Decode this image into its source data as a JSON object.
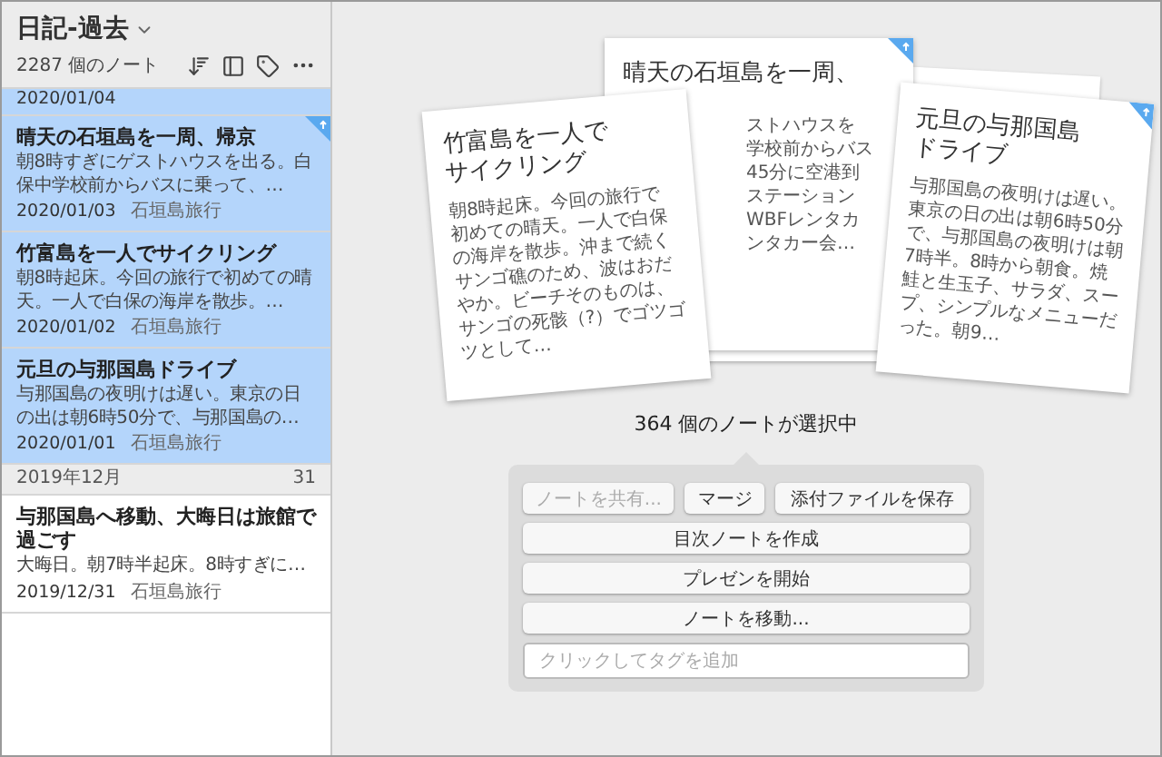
{
  "sidebar": {
    "title": "日記-過去",
    "note_count": "2287 個のノート",
    "notes": [
      {
        "kind": "partial",
        "date": "2020/01/04",
        "selected": true,
        "shortcut": false
      },
      {
        "kind": "note",
        "title": "晴天の石垣島を一周、帰京",
        "snippet": "朝8時すぎにゲストハウスを出る。白保中学校前からバスに乗って、…",
        "date": "2020/01/03",
        "tag": "石垣島旅行",
        "selected": true,
        "shortcut": true
      },
      {
        "kind": "note",
        "title": "竹富島を一人でサイクリング",
        "snippet": "朝8時起床。今回の旅行で初めての晴天。一人で白保の海岸を散歩。…",
        "date": "2020/01/02",
        "tag": "石垣島旅行",
        "selected": true,
        "shortcut": false
      },
      {
        "kind": "note",
        "title": "元旦の与那国島ドライブ",
        "snippet": "与那国島の夜明けは遅い。東京の日の出は朝6時50分で、与那国島の…",
        "date": "2020/01/01",
        "tag": "石垣島旅行",
        "selected": true,
        "shortcut": false
      },
      {
        "kind": "section",
        "label": "2019年12月",
        "count": "31"
      },
      {
        "kind": "note",
        "title": "与那国島へ移動、大晦日は旅館で過ごす",
        "snippet": "大晦日。朝7時半起床。8時すぎに…",
        "date": "2019/12/31",
        "tag": "石垣島旅行",
        "selected": false,
        "shortcut": false
      }
    ]
  },
  "preview": {
    "cards": [
      {
        "kind": "back",
        "title": "晴天の石垣島を一周、",
        "lines": [
          "ストハウスを",
          "学校前からバス",
          "45分に空港到",
          "ステーション",
          "WBFレンタカ",
          "ンタカー会…"
        ],
        "shortcut": true
      },
      {
        "kind": "left",
        "title": "竹富島を一人でサイクリング",
        "body": "朝8時起床。今回の旅行で初めての晴天。一人で白保の海岸を散歩。沖まで続くサンゴ礁のため、波はおだやか。ビーチそのものは、サンゴの死骸（?）でゴツゴツとして…",
        "shortcut": false
      },
      {
        "kind": "right",
        "title": "元旦の与那国島ドライブ",
        "body": "与那国島の夜明けは遅い。東京の日の出は朝6時50分で、与那国島の夜明けは朝7時半。8時から朝食。焼鮭と生玉子、サラダ、スープ、シンプルなメニューだった。朝9…",
        "shortcut": true
      }
    ],
    "selected_count": "364 個のノートが選択中",
    "actions": [
      {
        "kind": "row",
        "buttons": [
          {
            "label": "ノートを共有...",
            "disabled": true
          },
          {
            "label": "マージ",
            "disabled": false
          },
          {
            "label": "添付ファイルを保存",
            "disabled": false
          }
        ]
      },
      {
        "kind": "button",
        "label": "目次ノートを作成",
        "disabled": false
      },
      {
        "kind": "button",
        "label": "プレゼンを開始",
        "disabled": false
      },
      {
        "kind": "button",
        "label": "ノートを移動...",
        "disabled": false
      },
      {
        "kind": "field",
        "placeholder": "クリックしてタグを追加"
      }
    ]
  }
}
